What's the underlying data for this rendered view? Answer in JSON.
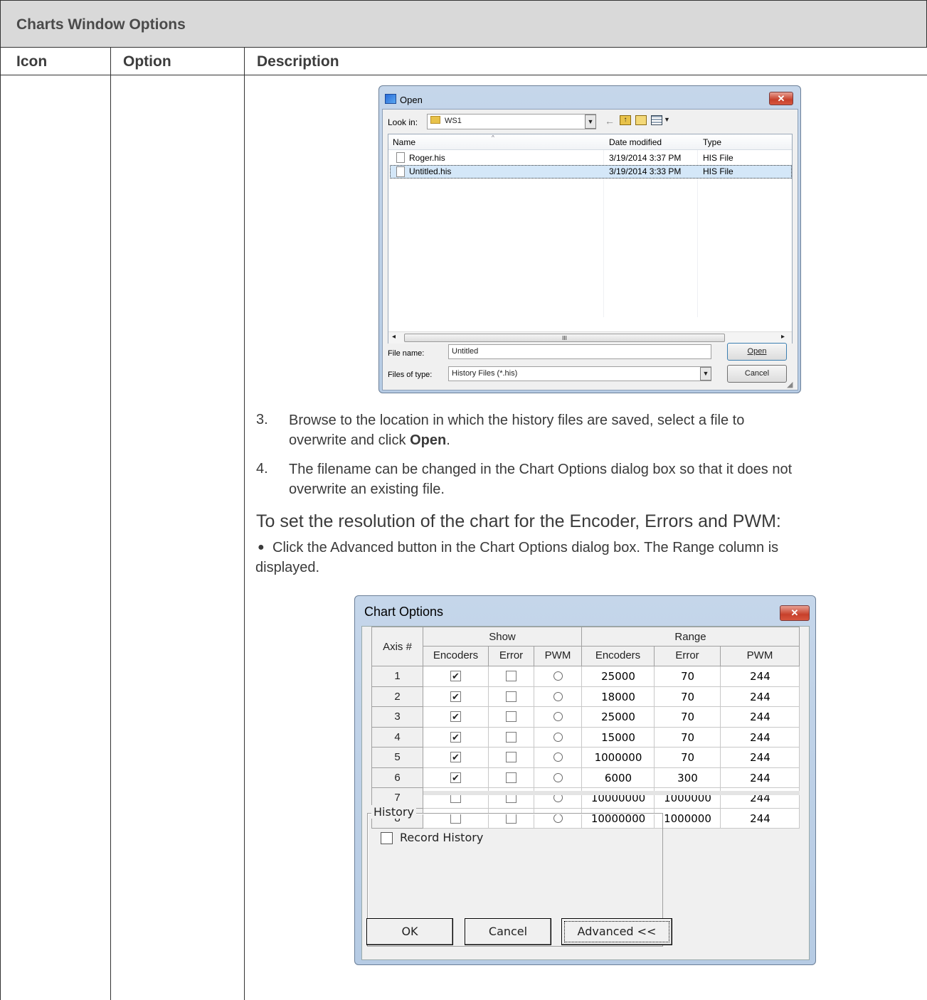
{
  "doc": {
    "section_title": "Charts Window Options",
    "columns": {
      "icon": "Icon",
      "option": "Option",
      "description": "Description"
    },
    "steps": [
      {
        "num": "3.",
        "text_a": "Browse to the location in which the history files are saved, select a file to",
        "text_b_pre": "overwrite and click ",
        "text_b_bold": "Open",
        "text_b_post": "."
      },
      {
        "num": "4.",
        "text_a": "The filename can be changed in the Chart Options dialog box so that it does not",
        "text_b": "overwrite an existing file."
      }
    ],
    "resolution_heading": "To set the resolution of the chart for the Encoder, Errors and PWM:",
    "bullet_a": "Click the Advanced button in the Chart Options dialog box. The Range column is",
    "bullet_b": "displayed."
  },
  "open_dialog": {
    "title": "Open",
    "look_in_label": "Look in:",
    "look_in_value": "WS1",
    "columns": {
      "name": "Name",
      "date": "Date modified",
      "type": "Type"
    },
    "files": [
      {
        "name": "Roger.his",
        "date": "3/19/2014 3:37 PM",
        "type": "HIS File"
      },
      {
        "name": "Untitled.his",
        "date": "3/19/2014 3:33 PM",
        "type": "HIS File"
      }
    ],
    "file_name_label": "File name:",
    "file_name_value": "Untitled",
    "file_type_label": "Files of type:",
    "file_type_value": "History Files (*.his)",
    "open_button": "Open",
    "cancel_button": "Cancel",
    "scroll_mid": "III"
  },
  "chart_options": {
    "title": "Chart Options",
    "axis_header": "Axis #",
    "show_header": "Show",
    "range_header": "Range",
    "sub_headers": [
      "Encoders",
      "Error",
      "PWM",
      "Encoders",
      "Error",
      "PWM"
    ],
    "rows": [
      {
        "axis": "1",
        "enc": true,
        "err": false,
        "enc_range": "25000",
        "err_range": "70",
        "pwm_range": "244"
      },
      {
        "axis": "2",
        "enc": true,
        "err": false,
        "enc_range": "18000",
        "err_range": "70",
        "pwm_range": "244"
      },
      {
        "axis": "3",
        "enc": true,
        "err": false,
        "enc_range": "25000",
        "err_range": "70",
        "pwm_range": "244"
      },
      {
        "axis": "4",
        "enc": true,
        "err": false,
        "enc_range": "15000",
        "err_range": "70",
        "pwm_range": "244"
      },
      {
        "axis": "5",
        "enc": true,
        "err": false,
        "enc_range": "1000000",
        "err_range": "70",
        "pwm_range": "244"
      },
      {
        "axis": "6",
        "enc": true,
        "err": false,
        "enc_range": "6000",
        "err_range": "300",
        "pwm_range": "244"
      },
      {
        "axis": "7",
        "enc": false,
        "err": false,
        "enc_range": "10000000",
        "err_range": "1000000",
        "pwm_range": "244"
      },
      {
        "axis": "8",
        "enc": false,
        "err": false,
        "enc_range": "10000000",
        "err_range": "1000000",
        "pwm_range": "244"
      }
    ],
    "history_group": "History",
    "record_history": "Record History",
    "ok_button": "OK",
    "cancel_button": "Cancel",
    "advanced_button": "Advanced <<",
    "check_glyph": "✔"
  },
  "colors": {
    "header_bg": "#d9d9d9",
    "title_blue": "#b6cbe4",
    "close_red": "#c7402b",
    "selection": "#cce8ff"
  }
}
